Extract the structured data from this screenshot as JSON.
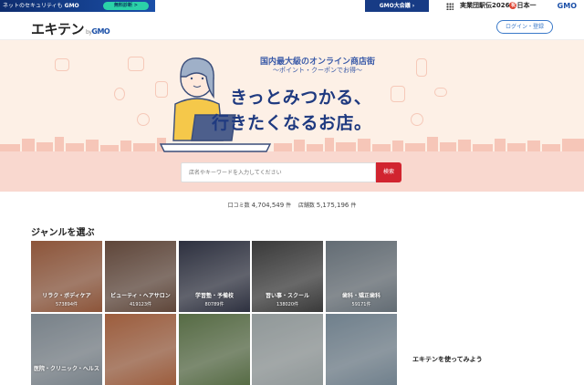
{
  "topbar": {
    "left_text": "ネットのセキュリティも",
    "left_gmo": "GMO",
    "left_pill": "無料診断 >",
    "mid_text": "GMO大会議 ›",
    "right_text_a": "実業団駅伝2026",
    "right_circle": "祝",
    "right_text_b": "日本一",
    "right_gmo": "GMO"
  },
  "header": {
    "logo": "エキテン",
    "logo_by": "by",
    "logo_gmo": "GMO",
    "login_label": "ログイン・登録"
  },
  "hero": {
    "subtitle1": "国内最大級のオンライン商店街",
    "subtitle2": "〜ポイント・クーポンでお得〜",
    "catch1": "きっとみつかる、",
    "catch2": "行きたくなるお店。"
  },
  "search": {
    "placeholder": "店名やキーワードを入力してください",
    "button_label": "検索"
  },
  "stats": {
    "reviews_label": "口コミ数",
    "reviews_value": "4,704,549",
    "reviews_unit": "件",
    "shops_label": "店舗数",
    "shops_value": "5,175,196",
    "shops_unit": "件"
  },
  "genres": {
    "title": "ジャンルを選ぶ",
    "items": [
      {
        "label": "リラク・ボディケア",
        "count": "573894件",
        "color": "#b56d4a"
      },
      {
        "label": "ビューティ・ヘアサロン",
        "count": "419123件",
        "color": "#7a5a4a"
      },
      {
        "label": "学習塾・予備校",
        "count": "80789件",
        "color": "#3b3f52"
      },
      {
        "label": "習い事・スクール",
        "count": "138020件",
        "color": "#4a4a4a"
      },
      {
        "label": "歯科・矯正歯科",
        "count": "59171件",
        "color": "#7f8b95"
      },
      {
        "label": "医院・クリニック・ヘルス",
        "count": "",
        "color": "#9aa6b0"
      },
      {
        "label": "",
        "count": "",
        "color": "#c9774e"
      },
      {
        "label": "",
        "count": "",
        "color": "#6f8a58"
      },
      {
        "label": "",
        "count": "",
        "color": "#b9c3c4"
      },
      {
        "label": "",
        "count": "",
        "color": "#8fa4b4"
      }
    ]
  },
  "sidebar": {
    "title": "エキテンを使ってみよう"
  }
}
